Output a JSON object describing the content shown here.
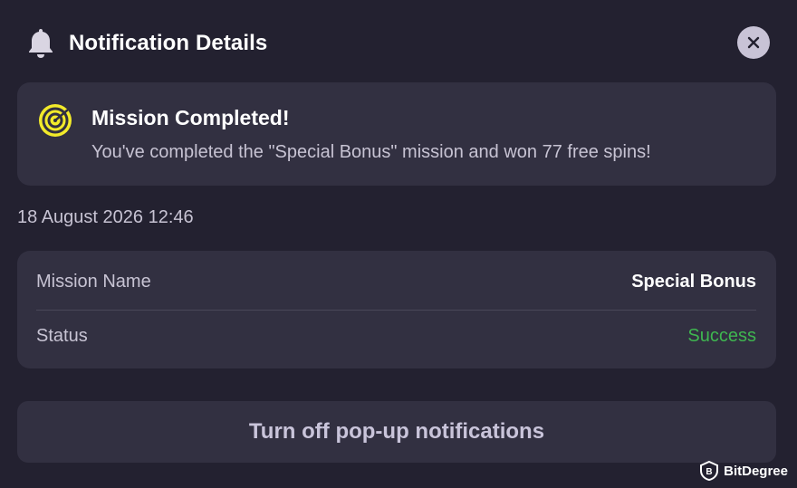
{
  "header": {
    "title": "Notification Details",
    "bell_icon": "bell-icon",
    "close_icon": "close-icon"
  },
  "notification": {
    "icon": "target-icon",
    "icon_color": "#f2ea2a",
    "title": "Mission Completed!",
    "message": "You've completed the \"Special Bonus\" mission and won 77 free spins!"
  },
  "timestamp": "18 August 2026 12:46",
  "details": {
    "rows": [
      {
        "label": "Mission Name",
        "value": "Special Bonus"
      },
      {
        "label": "Status",
        "value": "Success"
      }
    ],
    "success_color": "#3fb650"
  },
  "actions": {
    "turn_off_label": "Turn off pop-up notifications"
  },
  "watermark": {
    "text": "BitDegree",
    "icon": "bitdegree-logo-icon"
  },
  "colors": {
    "background": "#232130",
    "card": "#323041",
    "close_button": "#c8c3d6"
  }
}
